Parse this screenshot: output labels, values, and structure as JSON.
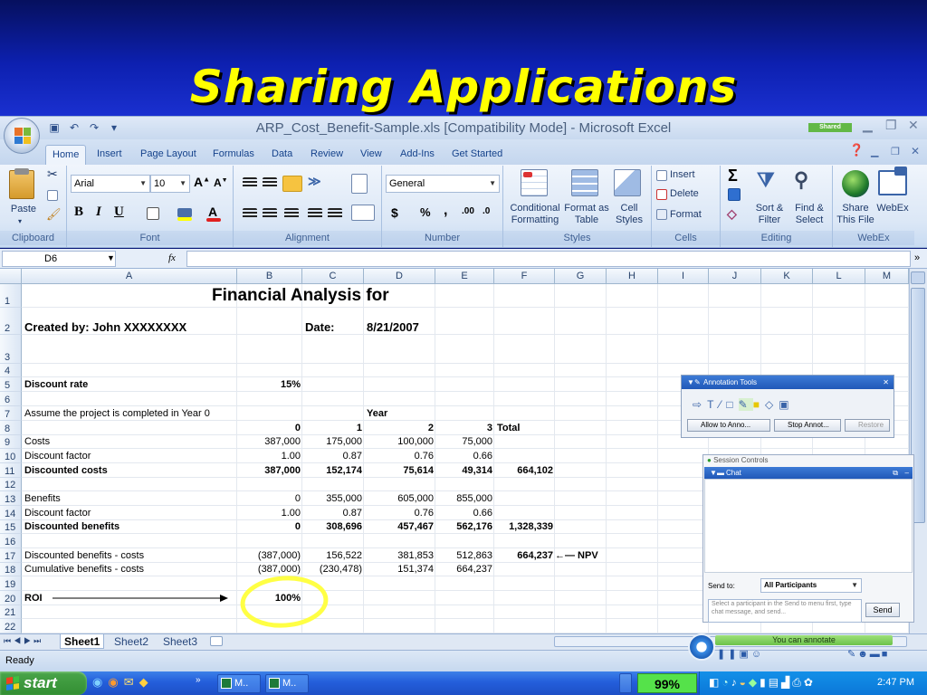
{
  "slide": {
    "title": "Sharing Applications"
  },
  "window": {
    "caption": "ARP_Cost_Benefit-Sample.xls  [Compatibility Mode] - Microsoft Excel",
    "shared_badge": "Shared"
  },
  "ribbon_tabs": [
    "Home",
    "Insert",
    "Page Layout",
    "Formulas",
    "Data",
    "Review",
    "View",
    "Add-Ins",
    "Get Started"
  ],
  "ribbon": {
    "clipboard": {
      "label": "Clipboard",
      "paste": "Paste"
    },
    "font": {
      "label": "Font",
      "name": "Arial",
      "size": "10"
    },
    "alignment": {
      "label": "Alignment"
    },
    "number": {
      "label": "Number",
      "format": "General"
    },
    "styles": {
      "label": "Styles",
      "conditional": "Conditional Formatting",
      "format_table": "Format as Table",
      "cell_styles": "Cell Styles"
    },
    "cells": {
      "label": "Cells",
      "insert": "Insert",
      "delete": "Delete",
      "format": "Format"
    },
    "editing": {
      "label": "Editing",
      "sort": "Sort & Filter",
      "find": "Find & Select"
    },
    "webex": {
      "label": "WebEx",
      "share": "Share This File",
      "webex": "WebEx"
    }
  },
  "formula_bar": {
    "name_box": "D6",
    "fx": "fx"
  },
  "columns": [
    "A",
    "B",
    "C",
    "D",
    "E",
    "F",
    "G",
    "H",
    "I",
    "J",
    "K",
    "L",
    "M"
  ],
  "rows": [
    {
      "n": "1",
      "cells": [
        {
          "c": "A",
          "t": "Financial Analysis for",
          "cls": "big"
        }
      ]
    },
    {
      "n": "2",
      "cells": [
        {
          "c": "A",
          "t": "Created by:  John XXXXXXXX",
          "cls": "b"
        },
        {
          "c": "C",
          "t": "Date:",
          "cls": "b"
        },
        {
          "c": "D",
          "t": "8/21/2007",
          "cls": "b"
        }
      ]
    },
    {
      "n": "3",
      "cells": []
    },
    {
      "n": "4",
      "cells": []
    },
    {
      "n": "5",
      "cells": [
        {
          "c": "A",
          "t": "Discount rate",
          "cls": "b"
        },
        {
          "c": "B",
          "t": "15%",
          "cls": "b r"
        }
      ]
    },
    {
      "n": "6",
      "cells": []
    },
    {
      "n": "7",
      "cells": [
        {
          "c": "A",
          "t": "Assume the project is completed in Year 0"
        },
        {
          "c": "D",
          "t": "Year",
          "cls": "b"
        }
      ]
    },
    {
      "n": "8",
      "cells": [
        {
          "c": "B",
          "t": "0",
          "cls": "b r"
        },
        {
          "c": "C",
          "t": "1",
          "cls": "b r"
        },
        {
          "c": "D",
          "t": "2",
          "cls": "b r"
        },
        {
          "c": "E",
          "t": "3",
          "cls": "b r"
        },
        {
          "c": "F",
          "t": "Total",
          "cls": "b"
        }
      ]
    },
    {
      "n": "9",
      "cells": [
        {
          "c": "A",
          "t": "Costs"
        },
        {
          "c": "B",
          "t": "387,000",
          "cls": "r"
        },
        {
          "c": "C",
          "t": "175,000",
          "cls": "r"
        },
        {
          "c": "D",
          "t": "100,000",
          "cls": "r"
        },
        {
          "c": "E",
          "t": "75,000",
          "cls": "r"
        }
      ]
    },
    {
      "n": "10",
      "cells": [
        {
          "c": "A",
          "t": "Discount factor"
        },
        {
          "c": "B",
          "t": "1.00",
          "cls": "r"
        },
        {
          "c": "C",
          "t": "0.87",
          "cls": "r"
        },
        {
          "c": "D",
          "t": "0.76",
          "cls": "r"
        },
        {
          "c": "E",
          "t": "0.66",
          "cls": "r"
        }
      ]
    },
    {
      "n": "11",
      "cells": [
        {
          "c": "A",
          "t": "Discounted costs",
          "cls": "b"
        },
        {
          "c": "B",
          "t": "387,000",
          "cls": "b r"
        },
        {
          "c": "C",
          "t": "152,174",
          "cls": "b r"
        },
        {
          "c": "D",
          "t": "75,614",
          "cls": "b r"
        },
        {
          "c": "E",
          "t": "49,314",
          "cls": "b r"
        },
        {
          "c": "F",
          "t": "664,102",
          "cls": "b r"
        }
      ]
    },
    {
      "n": "12",
      "cells": []
    },
    {
      "n": "13",
      "cells": [
        {
          "c": "A",
          "t": "Benefits"
        },
        {
          "c": "B",
          "t": "0",
          "cls": "r"
        },
        {
          "c": "C",
          "t": "355,000",
          "cls": "r"
        },
        {
          "c": "D",
          "t": "605,000",
          "cls": "r"
        },
        {
          "c": "E",
          "t": "855,000",
          "cls": "r"
        }
      ]
    },
    {
      "n": "14",
      "cells": [
        {
          "c": "A",
          "t": "Discount factor"
        },
        {
          "c": "B",
          "t": "1.00",
          "cls": "r"
        },
        {
          "c": "C",
          "t": "0.87",
          "cls": "r"
        },
        {
          "c": "D",
          "t": "0.76",
          "cls": "r"
        },
        {
          "c": "E",
          "t": "0.66",
          "cls": "r"
        }
      ]
    },
    {
      "n": "15",
      "cells": [
        {
          "c": "A",
          "t": "Discounted benefits",
          "cls": "b"
        },
        {
          "c": "B",
          "t": "0",
          "cls": "b r"
        },
        {
          "c": "C",
          "t": "308,696",
          "cls": "b r"
        },
        {
          "c": "D",
          "t": "457,467",
          "cls": "b r"
        },
        {
          "c": "E",
          "t": "562,176",
          "cls": "b r"
        },
        {
          "c": "F",
          "t": "1,328,339",
          "cls": "b r"
        }
      ]
    },
    {
      "n": "16",
      "cells": []
    },
    {
      "n": "17",
      "cells": [
        {
          "c": "A",
          "t": "Discounted benefits - costs"
        },
        {
          "c": "B",
          "t": "(387,000)",
          "cls": "r"
        },
        {
          "c": "C",
          "t": "156,522",
          "cls": "r"
        },
        {
          "c": "D",
          "t": "381,853",
          "cls": "r"
        },
        {
          "c": "E",
          "t": "512,863",
          "cls": "r"
        },
        {
          "c": "F",
          "t": "664,237",
          "cls": "b r"
        },
        {
          "c": "G",
          "t": "←— NPV",
          "cls": "b"
        }
      ]
    },
    {
      "n": "18",
      "cells": [
        {
          "c": "A",
          "t": "Cumulative benefits - costs"
        },
        {
          "c": "B",
          "t": "(387,000)",
          "cls": "r"
        },
        {
          "c": "C",
          "t": "(230,478)",
          "cls": "r"
        },
        {
          "c": "D",
          "t": "151,374",
          "cls": "r"
        },
        {
          "c": "E",
          "t": "664,237",
          "cls": "r"
        }
      ]
    },
    {
      "n": "19",
      "cells": []
    },
    {
      "n": "20",
      "cells": [
        {
          "c": "A",
          "t": "ROI",
          "cls": "b"
        },
        {
          "c": "B",
          "t": "100%",
          "cls": "b r"
        }
      ]
    },
    {
      "n": "21",
      "cells": []
    },
    {
      "n": "22",
      "cells": []
    }
  ],
  "sheets": [
    "Sheet1",
    "Sheet2",
    "Sheet3"
  ],
  "status_text": "Ready",
  "annotation": {
    "title": "Annotation Tools",
    "allow": "Allow to Anno...",
    "stop": "Stop Annot...",
    "restore": "Restore"
  },
  "session": {
    "title": "Session Controls",
    "chat_title": "Chat",
    "send_to_label": "Send to:",
    "recipient": "All Participants",
    "placeholder": "Select a participant in the Send to menu first, type chat message, and send...",
    "send": "Send",
    "banner": "You can annotate"
  },
  "taskbar": {
    "start": "start",
    "items": [
      "M..",
      "M.."
    ],
    "zoom": "99%",
    "clock": "2:47 PM"
  },
  "colors": {
    "title_text": "#ffff00",
    "highlight": "#ffff44",
    "webex_banner": "#6cc24a"
  }
}
